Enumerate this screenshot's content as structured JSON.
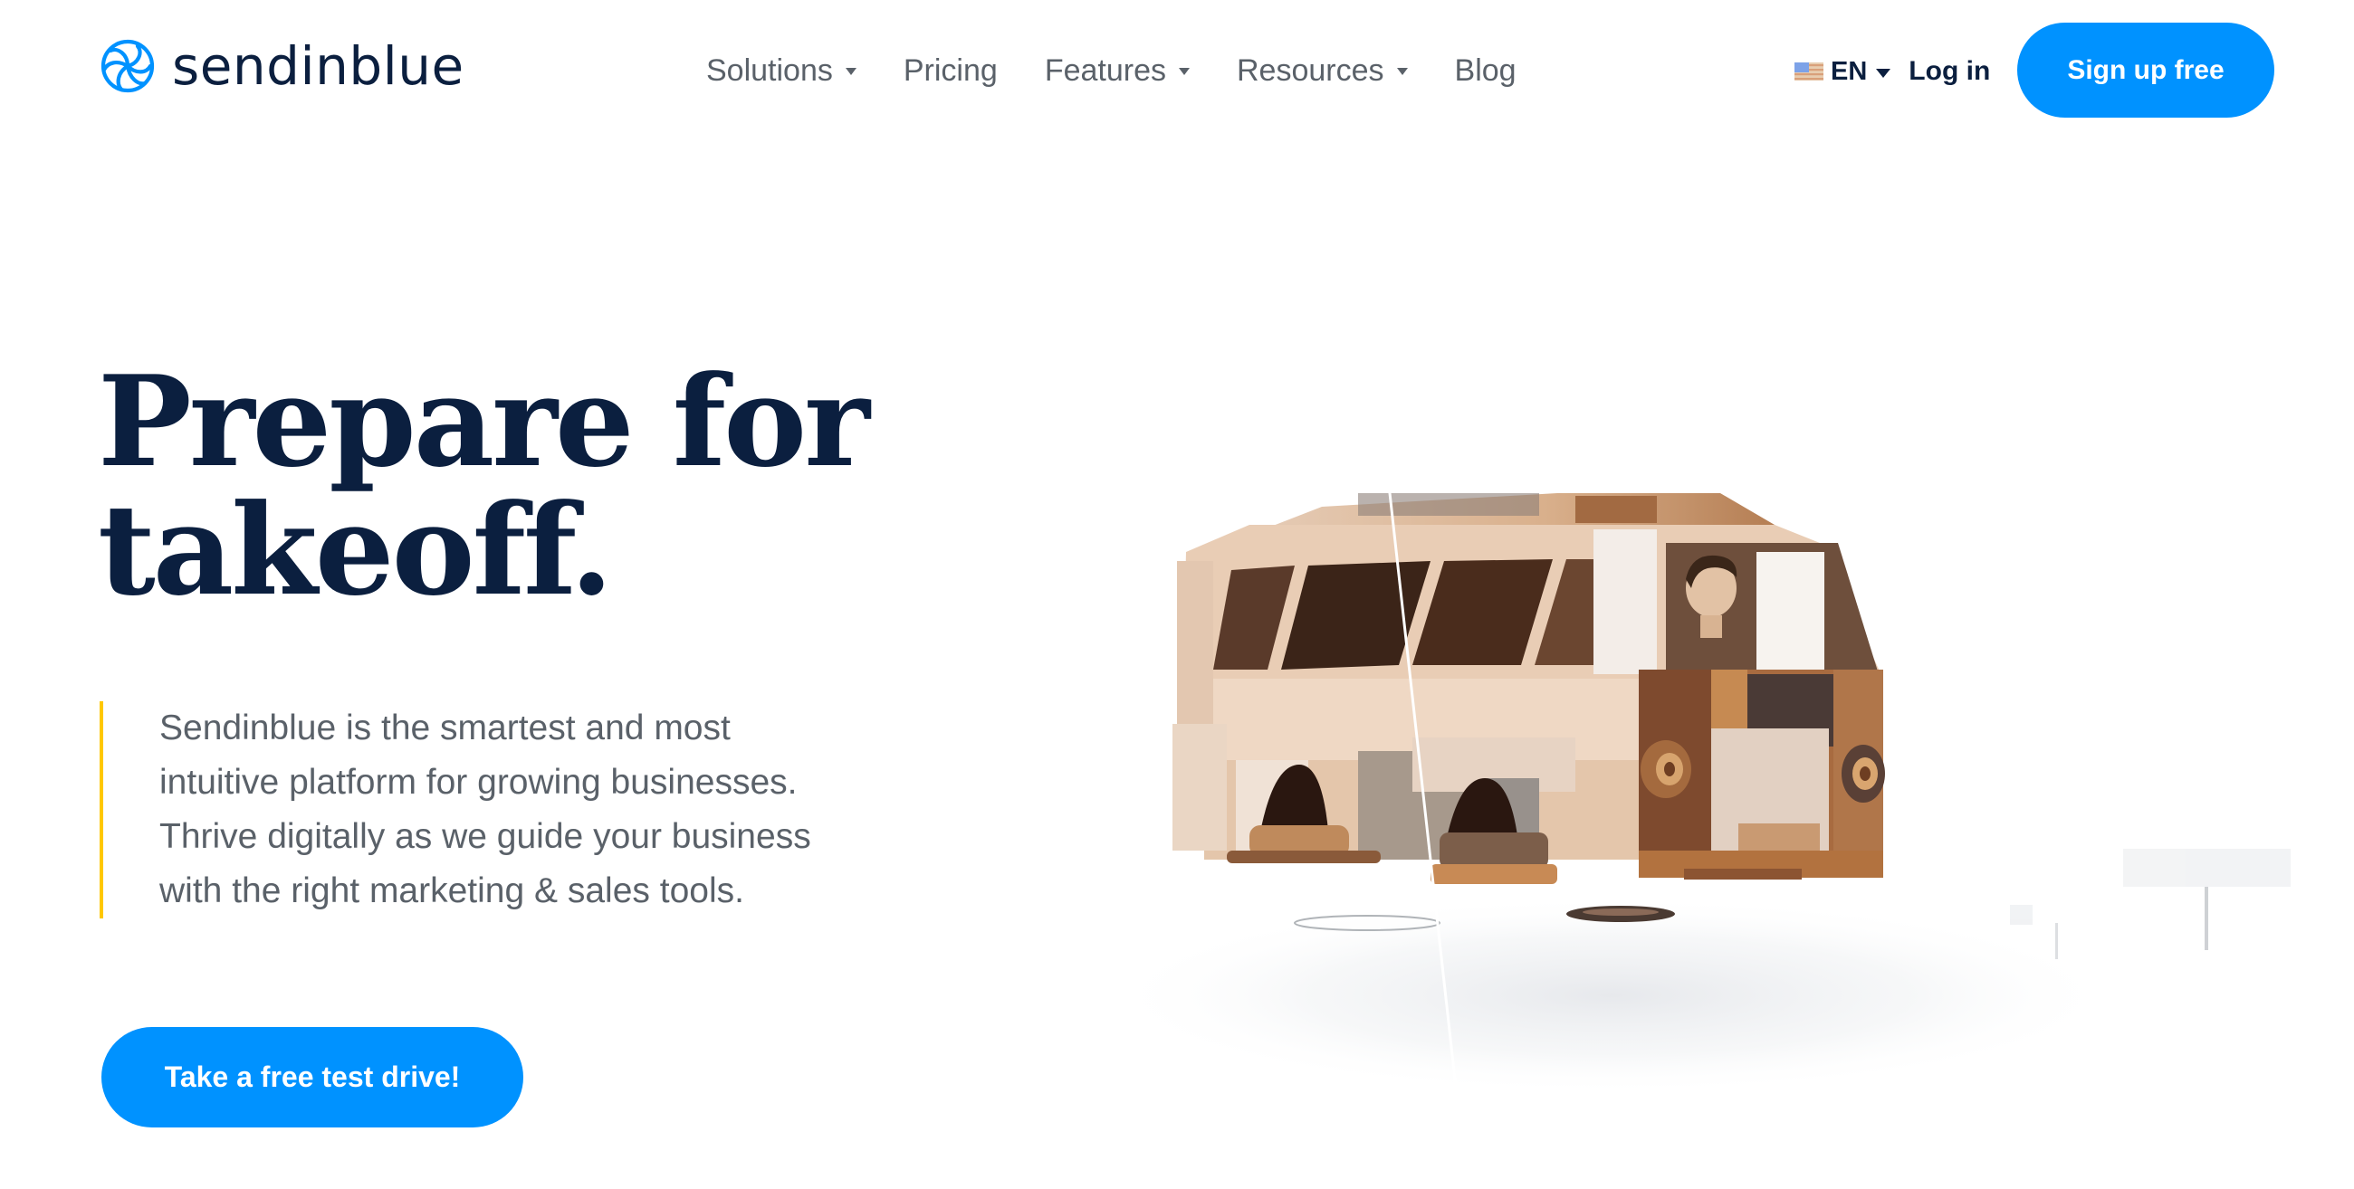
{
  "brand": {
    "name": "sendinblue",
    "primary_color": "#0092ff",
    "text_color": "#0b1f3f",
    "accent_color": "#ffc800"
  },
  "nav": {
    "items": [
      {
        "label": "Solutions",
        "has_dropdown": true
      },
      {
        "label": "Pricing",
        "has_dropdown": false
      },
      {
        "label": "Features",
        "has_dropdown": true
      },
      {
        "label": "Resources",
        "has_dropdown": true
      },
      {
        "label": "Blog",
        "has_dropdown": false
      }
    ]
  },
  "header_right": {
    "language": "EN",
    "language_icon": "us-flag-icon",
    "login_label": "Log in",
    "signup_label": "Sign up free"
  },
  "hero": {
    "title_lines": [
      "Prepare for",
      "takeoff."
    ],
    "description_lines": [
      "Sendinblue is the smartest and most",
      "intuitive platform for growing businesses.",
      "Thrive digitally as we guide your business",
      "with the right marketing & sales tools."
    ],
    "cta_label": "Take a free test drive!",
    "illustration": "wooden-van-illustration"
  }
}
